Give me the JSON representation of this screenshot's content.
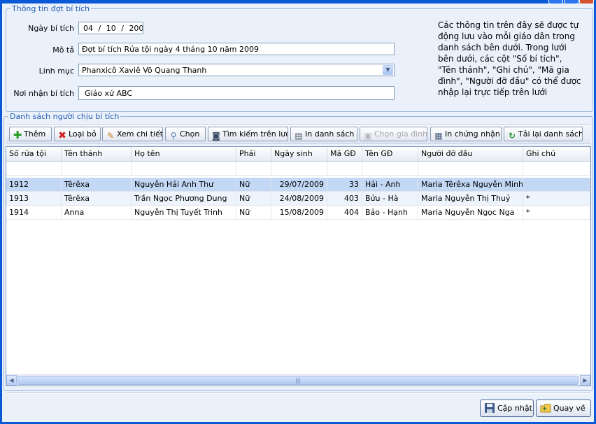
{
  "section1": {
    "legend": "Thông tin đợt bí tích",
    "date_label": "Ngày bí tích",
    "date": {
      "day": "04",
      "month": "10",
      "year": "2009"
    },
    "desc_label": "Mô tả",
    "desc_value": "Đợt bí tích Rửa tội ngày 4 tháng 10 năm 2009",
    "priest_label": "Linh mục",
    "priest_value": "Phanxicô Xaviê Võ Quang Thanh",
    "place_label": "Nơi nhận bí tích",
    "place_value": "Giáo xứ ABC",
    "info_text": "Các thông tin trên đây sẽ được tự động lưu vào mỗi giáo dân trong danh sách bên dưới. Trong lưới bên dưới, các cột \"Số bí tích\", \"Tên thánh\", \"Ghi chú\", \"Mã gia đình\", \"Người đỡ đầu\" có thể được nhập lại trực tiếp trên lưới"
  },
  "section2": {
    "legend": "Danh sách người chịu bí tích"
  },
  "toolbar": {
    "add": "Thêm",
    "remove": "Loại bỏ",
    "view": "Xem chi tiết",
    "choose": "Chọn",
    "search": "Tìm kiếm trên lưới",
    "print_list": "In danh sách",
    "choose_family": "Chọn gia đình",
    "print_cert": "In chứng nhận",
    "reload": "Tải lại danh sách"
  },
  "grid": {
    "columns": [
      "Số rửa tội",
      "Tên thánh",
      "Họ tên",
      "Phái",
      "Ngày sinh",
      "Mã GĐ",
      "Tên GĐ",
      "Người đỡ đầu",
      "Ghi chú"
    ],
    "rows": [
      [
        "1912",
        "Têrêxa",
        "Nguyễn Hải Anh Thư",
        "Nữ",
        "29/07/2009",
        "33",
        "Hải - Anh",
        "Maria Têrêxa Nguyễn Minh ...",
        ""
      ],
      [
        "1913",
        "Têrêxa",
        "Trần Ngọc Phương Dung",
        "Nữ",
        "24/08/2009",
        "403",
        "Bửu - Hà",
        "Maria Nguyễn Thị Thuỷ",
        "*"
      ],
      [
        "1914",
        "Anna",
        "Nguyễn Thị Tuyết Trinh",
        "Nữ",
        "15/08/2009",
        "404",
        "Bảo - Hạnh",
        "Maria Nguyễn Ngọc Nga",
        "*"
      ]
    ]
  },
  "footer": {
    "update": "Cập nhật",
    "back": "Quay về"
  },
  "colors": {
    "accent": "#0a5ad8",
    "legend": "#1f5ab0",
    "selected_row": "#c2d8f5"
  }
}
